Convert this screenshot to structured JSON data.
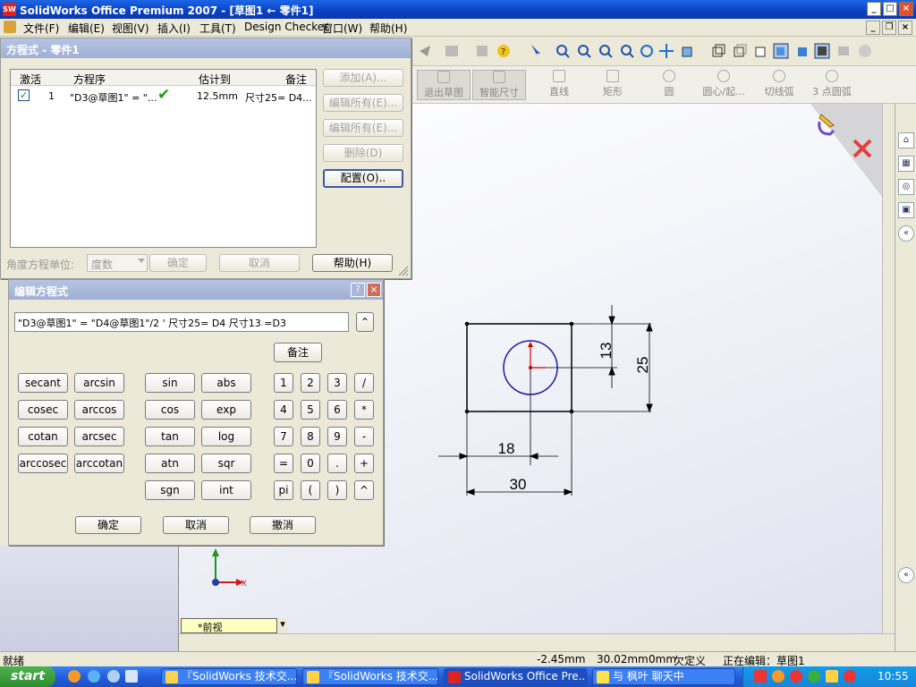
{
  "window": {
    "title": "SolidWorks Office Premium 2007 - [草图1 ← 零件1]",
    "logo_text": "SW",
    "btn_minimize": "_",
    "btn_maximize": "□",
    "btn_close": "×"
  },
  "menu": {
    "items": [
      "文件(F)",
      "编辑(E)",
      "视图(V)",
      "插入(I)",
      "工具(T)",
      "Design Checker",
      "窗口(W)",
      "帮助(H)"
    ],
    "doc_btn_minimize": "_",
    "doc_btn_restore": "❐",
    "doc_btn_close": "×"
  },
  "sketch_toolbar": {
    "items": [
      "退出草图",
      "智能尺寸",
      "直线",
      "矩形",
      "圆",
      "圆心/起...",
      "切线弧",
      "3 点圆弧"
    ]
  },
  "equations_dialog": {
    "title": "方程式 - 零件1",
    "columns": [
      "激活",
      "方程序",
      "估计到",
      "备注"
    ],
    "rows": [
      {
        "index": "1",
        "equation": "\"D3@草图1\" = \"...",
        "value": "12.5mm",
        "note": "尺寸25= D4..."
      }
    ],
    "check_mark": "✔",
    "buttons": {
      "add": "添加(A)...",
      "edit_all_1": "编辑所有(E)...",
      "edit_all_2": "编辑所有(E)...",
      "delete": "删除(D)",
      "configure": "配置(O)..",
      "ok": "确定",
      "cancel": "取消",
      "help": "帮助(H)"
    },
    "angle_unit_label": "角度方程单位:",
    "angle_unit_value": "度数"
  },
  "edit_dialog": {
    "title": "编辑方程式",
    "help_icon": "?",
    "close_icon": "×",
    "expression": "\"D3@草图1\" = \"D4@草图1\"/2  ' 尺寸25= D4  尺寸13 =D3",
    "collapse_icon": "⌃",
    "note_button": "备注",
    "func_col1": [
      "secant",
      "cosec",
      "cotan",
      "arccosec"
    ],
    "func_col2": [
      "arcsin",
      "arccos",
      "arcsec",
      "arccotan"
    ],
    "func_col3": [
      "sin",
      "cos",
      "tan",
      "atn",
      "sgn"
    ],
    "func_col4": [
      "abs",
      "exp",
      "log",
      "sqr",
      "int"
    ],
    "keys": [
      [
        "1",
        "2",
        "3",
        "/"
      ],
      [
        "4",
        "5",
        "6",
        "*"
      ],
      [
        "7",
        "8",
        "9",
        "-"
      ],
      [
        "=",
        "0",
        ".",
        "+"
      ],
      [
        "pi",
        "(",
        ")",
        "^"
      ]
    ],
    "ok": "确定",
    "cancel": "取消",
    "undo": "撤消"
  },
  "sketch": {
    "dims": {
      "d13": "13",
      "d25": "25",
      "d18": "18",
      "d30": "30"
    },
    "colors": {
      "geometry": "#000000",
      "circle": "#1a1aa8",
      "origin": "#cc0000"
    }
  },
  "view_tab": {
    "label": "*前视",
    "arrow": "▾"
  },
  "triad": {
    "x_label": "X"
  },
  "taskpane": {
    "icons": [
      "⌂",
      "▦",
      "◎",
      "▣",
      "«",
      "«"
    ]
  },
  "statusbar": {
    "ready": "就绪",
    "x": "-2.45mm",
    "y": "30.02mm",
    "z": "0mm",
    "state": "欠定义",
    "editing": "正在编辑：草图1"
  },
  "taskbar": {
    "start": "start",
    "tasks": [
      "『SolidWorks 技术交...",
      "『SolidWorks 技术交...",
      "SolidWorks Office Pre...",
      "与 枫叶 聊天中"
    ],
    "clock": "10:55"
  }
}
